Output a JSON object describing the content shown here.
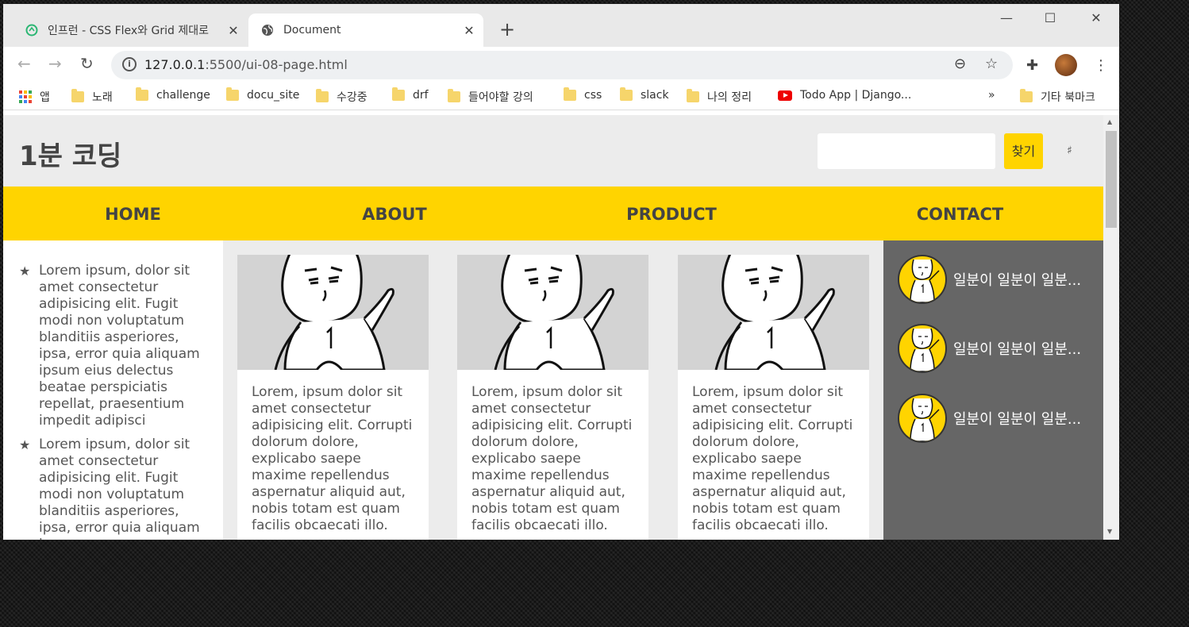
{
  "browser": {
    "tabs": [
      {
        "title": "인프런 - CSS Flex와 Grid 제대로",
        "close": "✕"
      },
      {
        "title": "Document",
        "close": "✕"
      }
    ],
    "new_tab": "+",
    "window_controls": {
      "minimize": "—",
      "maximize": "☐",
      "close": "✕"
    },
    "url_host": "127.0.0.1",
    "url_rest": ":5500/ui-08-page.html",
    "bookmarks": [
      "앱",
      "노래",
      "challenge",
      "docu_site",
      "수강중",
      "drf",
      "들어야할 강의",
      "css",
      "slack",
      "나의 정리",
      "Todo App | Django...",
      "»",
      "기타 북마크"
    ]
  },
  "page": {
    "logo": "1분 코딩",
    "search_button": "찾기",
    "hamburger": "♯",
    "nav": [
      "HOME",
      "ABOUT",
      "PRODUCT",
      "CONTACT"
    ],
    "left_items": [
      "Lorem ipsum, dolor sit amet consectetur adipisicing elit. Fugit modi non voluptatum blanditiis asperiores, ipsa, error quia aliquam ipsum eius delectus beatae perspiciatis repellat, praesentium impedit adipisci",
      "Lorem ipsum, dolor sit amet consectetur adipisicing elit. Fugit modi non voluptatum blanditiis asperiores, ipsa, error quia aliquam ipsum"
    ],
    "cards": [
      {
        "text": "Lorem, ipsum dolor sit amet consectetur adipisicing elit. Corrupti dolorum dolore, explicabo saepe maxime repellendus aspernatur aliquid aut, nobis totam est quam facilis obcaecati illo."
      },
      {
        "text": "Lorem, ipsum dolor sit amet consectetur adipisicing elit. Corrupti dolorum dolore, explicabo saepe maxime repellendus aspernatur aliquid aut, nobis totam est quam facilis obcaecati illo."
      },
      {
        "text": "Lorem, ipsum dolor sit amet consectetur adipisicing elit. Corrupti dolorum dolore, explicabo saepe maxime repellendus aspernatur aliquid aut, nobis totam est quam facilis obcaecati illo."
      }
    ],
    "right_items": [
      "일분이 일분이 일분...",
      "일분이 일분이 일분...",
      "일분이 일분이 일분..."
    ]
  },
  "colors": {
    "accent": "#ffd400",
    "sidebar_right": "#666666",
    "page_bg": "#ececec"
  }
}
